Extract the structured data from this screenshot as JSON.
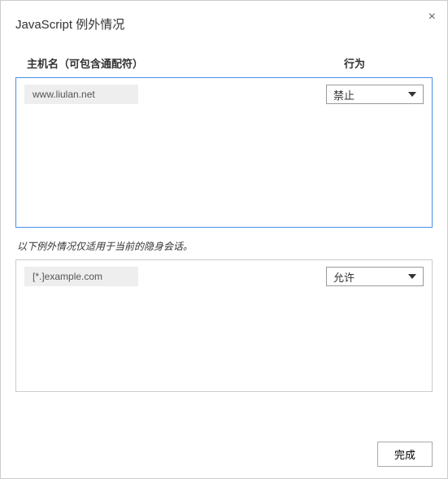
{
  "dialog": {
    "title": "JavaScript 例外情况",
    "close_symbol": "×"
  },
  "headers": {
    "hostname": "主机名（可包含通配符）",
    "behavior": "行为"
  },
  "exceptions": [
    {
      "host": "www.liulan.net",
      "action": "禁止"
    }
  ],
  "incognito_note": "以下例外情况仅适用于当前的隐身会话。",
  "incognito_exceptions": [
    {
      "host": "[*.]example.com",
      "action": "允许"
    }
  ],
  "footer": {
    "done": "完成"
  }
}
